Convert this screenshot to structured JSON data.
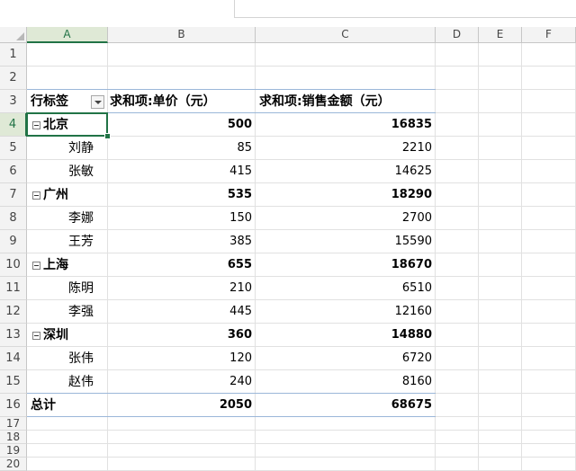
{
  "columns": [
    "A",
    "B",
    "C",
    "D",
    "E",
    "F"
  ],
  "rows": [
    "1",
    "2",
    "3",
    "4",
    "5",
    "6",
    "7",
    "8",
    "9",
    "10",
    "11",
    "12",
    "13",
    "14",
    "15",
    "16",
    "17",
    "18",
    "19",
    "20"
  ],
  "pivot": {
    "header": {
      "row_label": "行标签",
      "col_b": "求和项:单价（元）",
      "col_c": "求和项:销售金额（元）"
    },
    "rows": [
      {
        "label": "北京",
        "b": "500",
        "c": "16835",
        "level": 0
      },
      {
        "label": "刘静",
        "b": "85",
        "c": "2210",
        "level": 1
      },
      {
        "label": "张敏",
        "b": "415",
        "c": "14625",
        "level": 1
      },
      {
        "label": "广州",
        "b": "535",
        "c": "18290",
        "level": 0
      },
      {
        "label": "李娜",
        "b": "150",
        "c": "2700",
        "level": 1
      },
      {
        "label": "王芳",
        "b": "385",
        "c": "15590",
        "level": 1
      },
      {
        "label": "上海",
        "b": "655",
        "c": "18670",
        "level": 0
      },
      {
        "label": "陈明",
        "b": "210",
        "c": "6510",
        "level": 1
      },
      {
        "label": "李强",
        "b": "445",
        "c": "12160",
        "level": 1
      },
      {
        "label": "深圳",
        "b": "360",
        "c": "14880",
        "level": 0
      },
      {
        "label": "张伟",
        "b": "120",
        "c": "6720",
        "level": 1
      },
      {
        "label": "赵伟",
        "b": "240",
        "c": "8160",
        "level": 1
      }
    ],
    "total": {
      "label": "总计",
      "b": "2050",
      "c": "68675"
    }
  },
  "selected_cell": "A4",
  "colors": {
    "accent": "#217346",
    "pivot_border": "#9bb7d9"
  }
}
